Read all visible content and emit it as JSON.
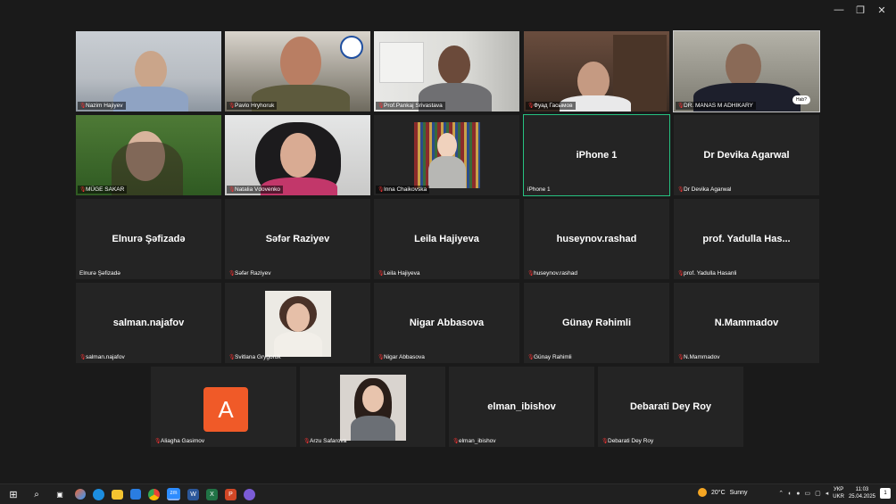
{
  "window": {
    "min": "—",
    "restore": "❐",
    "close": "✕"
  },
  "row1": [
    {
      "label": "Nazim Hajiyev"
    },
    {
      "label": "Pavlo Hryhoruk"
    },
    {
      "label": "Prof.Pankaj Srivastava"
    },
    {
      "label": "Фуад Гасымов"
    },
    {
      "label": "DR. MANAS M ADHIKARY",
      "bubble": "Hab?"
    }
  ],
  "row2": [
    {
      "label": "MÜGE SAKAR"
    },
    {
      "label": "Natalia Vdovenko"
    },
    {
      "label": "Inna Chaikovska"
    },
    {
      "name": "iPhone 1",
      "label": "iPhone 1"
    },
    {
      "name": "Dr Devika Agarwal",
      "label": "Dr Devika Agarwal"
    }
  ],
  "row3": [
    {
      "name": "Elnurə Şəfizadə",
      "label": "Elnurə Şəfizadə"
    },
    {
      "name": "Səfər Raziyev",
      "label": "Səfər Raziyev"
    },
    {
      "name": "Leila Hajiyeva",
      "label": "Leila Hajiyeva"
    },
    {
      "name": "huseynov.rashad",
      "label": "huseynov.rashad"
    },
    {
      "name": "prof. Yadulla Has...",
      "label": "prof. Yadulla Hasanli"
    }
  ],
  "row4": [
    {
      "name": "salman.najafov",
      "label": "salman.najafov"
    },
    {
      "label": "Svitlana Grygoruk"
    },
    {
      "name": "Nigar Abbasova",
      "label": "Nigar Abbasova"
    },
    {
      "name": "Günay Rəhimli",
      "label": "Günay Rahimli"
    },
    {
      "name": "N.Mammadov",
      "label": "N.Mammadov"
    }
  ],
  "row5": [
    {
      "avatar": "A",
      "label": "Aliagha Gasimov"
    },
    {
      "label": "Arzu Safarova"
    },
    {
      "name": "elman_ibishov",
      "label": "elman_ibishov"
    },
    {
      "name": "Debarati Dey Roy",
      "label": "Debarati Dey Roy"
    }
  ],
  "taskbar": {
    "weather_temp": "20°C",
    "weather_text": "Sunny",
    "lang_top": "УКР",
    "lang_bottom": "UKR",
    "time": "11:03",
    "date": "25.04.2025",
    "notif": "1"
  },
  "colors": {
    "active_border": "#26c281",
    "avatar": "#f05a28",
    "tile": "#242424",
    "bg": "#1a1a1a"
  }
}
